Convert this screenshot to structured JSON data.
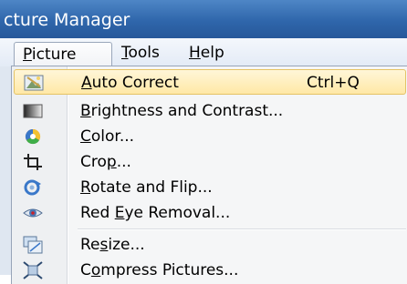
{
  "window": {
    "title": "cture Manager"
  },
  "menubar": {
    "items": [
      {
        "label": "Picture",
        "mnemonic": "P",
        "rest": "icture"
      },
      {
        "label": "Tools",
        "mnemonic": "T",
        "rest": "ools"
      },
      {
        "label": "Help",
        "mnemonic": "H",
        "rest": "elp"
      }
    ]
  },
  "dropdown": {
    "items": [
      {
        "label": "Auto Correct",
        "pre": "",
        "mnemonic": "A",
        "rest": "uto Correct",
        "shortcut": "Ctrl+Q",
        "icon": "auto-correct-icon",
        "highlighted": true
      },
      {
        "label": "Brightness and Contrast...",
        "pre": "",
        "mnemonic": "B",
        "rest": "rightness and Contrast...",
        "shortcut": "",
        "icon": "brightness-icon"
      },
      {
        "label": "Color...",
        "pre": "",
        "mnemonic": "C",
        "rest": "olor...",
        "shortcut": "",
        "icon": "color-icon"
      },
      {
        "label": "Crop...",
        "pre": "Cro",
        "mnemonic": "p",
        "rest": "...",
        "shortcut": "",
        "icon": "crop-icon"
      },
      {
        "label": "Rotate and Flip...",
        "pre": "",
        "mnemonic": "R",
        "rest": "otate and Flip...",
        "shortcut": "",
        "icon": "rotate-icon"
      },
      {
        "label": "Red Eye Removal...",
        "pre": "Red ",
        "mnemonic": "E",
        "rest": "ye Removal...",
        "shortcut": "",
        "icon": "red-eye-icon"
      },
      {
        "label": "Resize...",
        "pre": "Re",
        "mnemonic": "s",
        "rest": "ize...",
        "shortcut": "",
        "icon": "resize-icon"
      },
      {
        "label": "Compress Pictures...",
        "pre": "C",
        "mnemonic": "o",
        "rest": "mpress Pictures...",
        "shortcut": "",
        "icon": "compress-icon"
      }
    ]
  }
}
